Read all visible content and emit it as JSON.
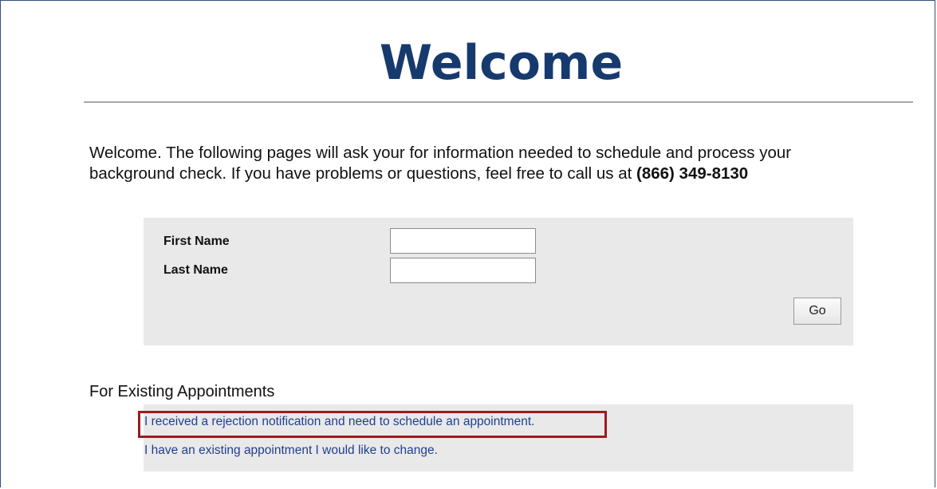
{
  "header": {
    "title": "Welcome"
  },
  "intro": {
    "text": "Welcome. The following pages will ask your for information needed to schedule and process your background check. If you have problems or questions, feel free to call us at ",
    "phone": "(866) 349-8130"
  },
  "login_form": {
    "first_name_label": "First Name",
    "first_name_value": "",
    "last_name_label": "Last Name",
    "last_name_value": "",
    "go_label": "Go"
  },
  "existing": {
    "heading": "For Existing Appointments",
    "links": [
      {
        "label": "I received a rejection notification and need to schedule an appointment.",
        "highlighted": true
      },
      {
        "label": "I have an existing appointment I would like to change.",
        "highlighted": false
      }
    ]
  },
  "colors": {
    "title": "#163a6e",
    "link": "#1f3f8f",
    "panel_background": "#e9e9e9",
    "highlight_border": "#9b1c1f"
  }
}
